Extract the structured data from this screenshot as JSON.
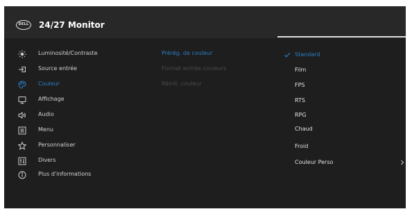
{
  "header": {
    "logo_text": "DELL",
    "title": "24/27 Monitor"
  },
  "menu": [
    {
      "label": "Luminosité/Contraste",
      "icon": "brightness-icon"
    },
    {
      "label": "Source entrée",
      "icon": "input-source-icon"
    },
    {
      "label": "Couleur",
      "icon": "color-palette-icon",
      "active": true
    },
    {
      "label": "Affichage",
      "icon": "display-icon"
    },
    {
      "label": "Audio",
      "icon": "speaker-icon"
    },
    {
      "label": "Menu",
      "icon": "menu-list-icon"
    },
    {
      "label": "Personnaliser",
      "icon": "star-icon"
    },
    {
      "label": "Divers",
      "icon": "misc-settings-icon"
    },
    {
      "label": "Plus d'informations",
      "icon": "info-icon"
    }
  ],
  "submenu": [
    {
      "label": "Prérég. de couleur",
      "state": "active"
    },
    {
      "label": "Format entrée couleurs",
      "state": "disabled"
    },
    {
      "label": "Réinit. couleur",
      "state": "disabled"
    }
  ],
  "options": [
    {
      "label": "Standard",
      "selected": true
    },
    {
      "label": "Film"
    },
    {
      "label": "FPS"
    },
    {
      "label": "RTS"
    },
    {
      "label": "RPG"
    },
    {
      "label": "Chaud"
    },
    {
      "label": "Froid"
    },
    {
      "label": "Couleur Perso",
      "has_submenu": true
    }
  ],
  "colors": {
    "accent": "#2c7fc8",
    "panel": "#1e1e1e",
    "header": "#282828",
    "text": "#d2d2d2",
    "disabled": "#4a4a4a"
  }
}
